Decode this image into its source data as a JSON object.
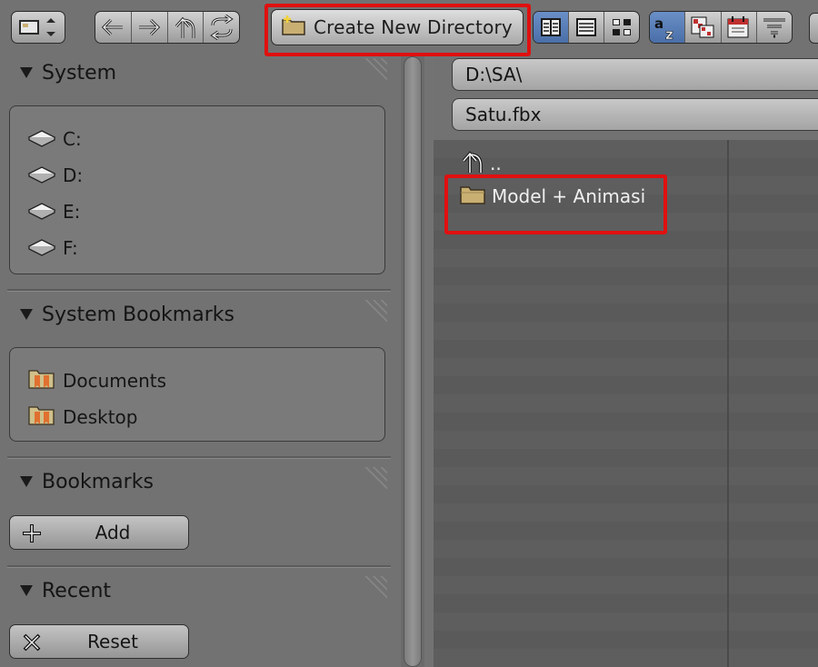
{
  "toolbar": {
    "create_new_directory": "Create New Directory"
  },
  "sidebar": {
    "system": {
      "title": "System",
      "drives": [
        "C:",
        "D:",
        "E:",
        "F:"
      ]
    },
    "system_bookmarks": {
      "title": "System Bookmarks",
      "items": [
        "Documents",
        "Desktop"
      ]
    },
    "bookmarks": {
      "title": "Bookmarks",
      "add_label": "Add"
    },
    "recent": {
      "title": "Recent",
      "reset_label": "Reset"
    }
  },
  "file_browser": {
    "directory_path": "D:\\SA\\",
    "file_name": "Satu.fbx",
    "parent_entry": "..",
    "entries": [
      "Model + Animasi"
    ]
  },
  "colors": {
    "highlight": "#e01010",
    "active_toggle": "#4a6fa8",
    "folder": "#c9b072"
  },
  "icons": [
    "editor-type-icon",
    "back-arrow-icon",
    "forward-arrow-icon",
    "parent-directory-icon",
    "refresh-icon",
    "new-folder-icon",
    "thumbnail-view-icon",
    "list-view-icon",
    "short-list-view-icon",
    "sort-alphabetical-icon",
    "sort-extension-icon",
    "sort-date-icon",
    "filter-icon",
    "drive-icon",
    "bookmark-folder-icon",
    "plus-icon",
    "x-icon",
    "folder-icon"
  ]
}
